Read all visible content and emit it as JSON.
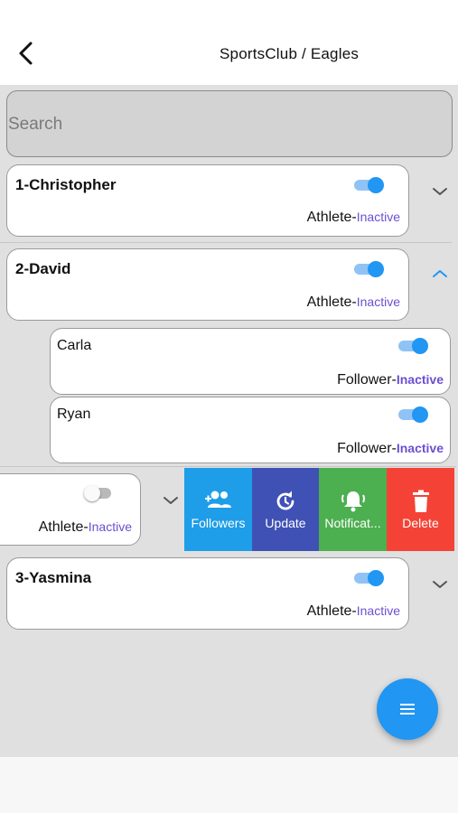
{
  "header": {
    "title": "SportsClub / Eagles",
    "back_icon": "chevron-left-icon"
  },
  "search": {
    "placeholder": "Search"
  },
  "members": [
    {
      "name": "1-Christopher",
      "role": "Athlete-",
      "status": "Inactive",
      "toggle": true,
      "expanded": false
    },
    {
      "name": "2-David",
      "role": "Athlete-",
      "status": "Inactive",
      "toggle": true,
      "expanded": true,
      "followers": [
        {
          "name": "Carla",
          "role": "Follower-",
          "status": "Inactive",
          "toggle": true
        },
        {
          "name": "Ryan",
          "role": "Follower-",
          "status": "Inactive",
          "toggle": true
        }
      ]
    },
    {
      "role": "Athlete-",
      "status": "Inactive",
      "toggle": false,
      "expanded": false,
      "swipe_actions": [
        {
          "label": "Followers",
          "icon": "add-followers-icon",
          "color": "#1e9de8"
        },
        {
          "label": "Update",
          "icon": "refresh-icon",
          "color": "#3f51b5"
        },
        {
          "label": "Notificat...",
          "icon": "notification-bell-icon",
          "color": "#4caf50"
        },
        {
          "label": "Delete",
          "icon": "trash-icon",
          "color": "#f44336"
        }
      ]
    },
    {
      "name": "3-Yasmina",
      "role": "Athlete-",
      "status": "Inactive",
      "toggle": true,
      "expanded": false
    }
  ],
  "fab": {
    "icon": "menu-icon",
    "color": "#2196f3"
  },
  "colors": {
    "accent": "#2196f3",
    "status_text": "#6b4fd2",
    "content_bg": "#e0e0e0"
  }
}
